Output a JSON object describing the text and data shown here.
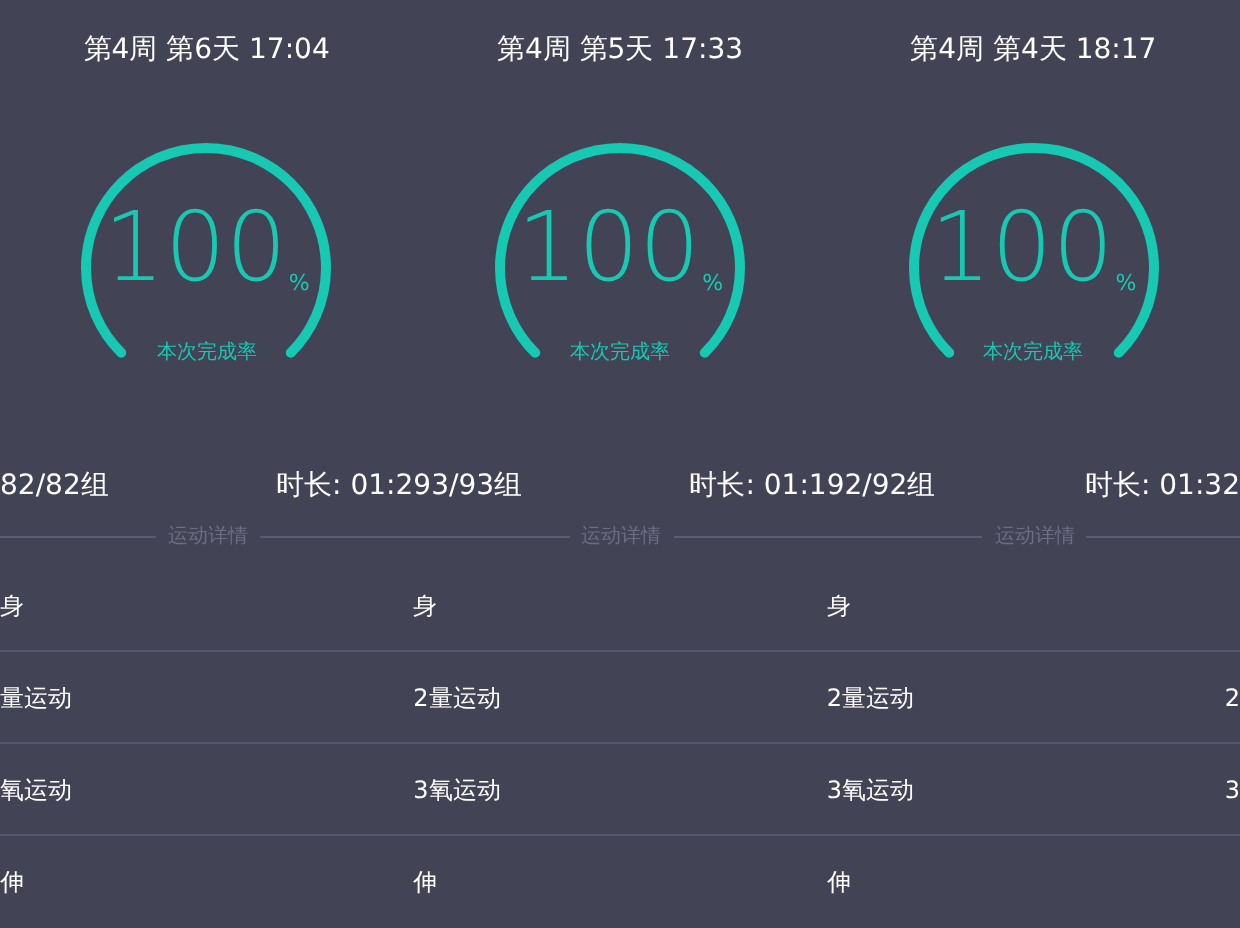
{
  "panels": [
    {
      "header": "第4周 第6天 17:04",
      "gauge": {
        "value": "100",
        "unit": "%",
        "caption": "本次完成率"
      },
      "stats": {
        "sets": "82/82组",
        "duration": "时长: 01:2"
      },
      "section_title": "运动详情",
      "rows": [
        {
          "name": "身"
        },
        {
          "name": "量运动"
        },
        {
          "name": "氧运动"
        },
        {
          "name": "伸"
        }
      ]
    },
    {
      "header": "第4周 第5天 17:33",
      "gauge": {
        "value": "100",
        "unit": "%",
        "caption": "本次完成率"
      },
      "stats": {
        "sets": "93/93组",
        "duration": "时长: 01:1"
      },
      "section_title": "运动详情",
      "rows": [
        {
          "name": "身"
        },
        {
          "name": "2量运动"
        },
        {
          "name": "3氧运动"
        },
        {
          "name": "伸"
        }
      ]
    },
    {
      "header": "第4周 第4天 18:17",
      "gauge": {
        "value": "100",
        "unit": "%",
        "caption": "本次完成率"
      },
      "stats": {
        "sets": "92/92组",
        "duration": "时长: 01:32"
      },
      "section_title": "运动详情",
      "rows": [
        {
          "name": "身"
        },
        {
          "name": "2量运动",
          "edge": "2"
        },
        {
          "name": "3氧运动",
          "edge": "3"
        },
        {
          "name": "伸"
        }
      ]
    }
  ]
}
